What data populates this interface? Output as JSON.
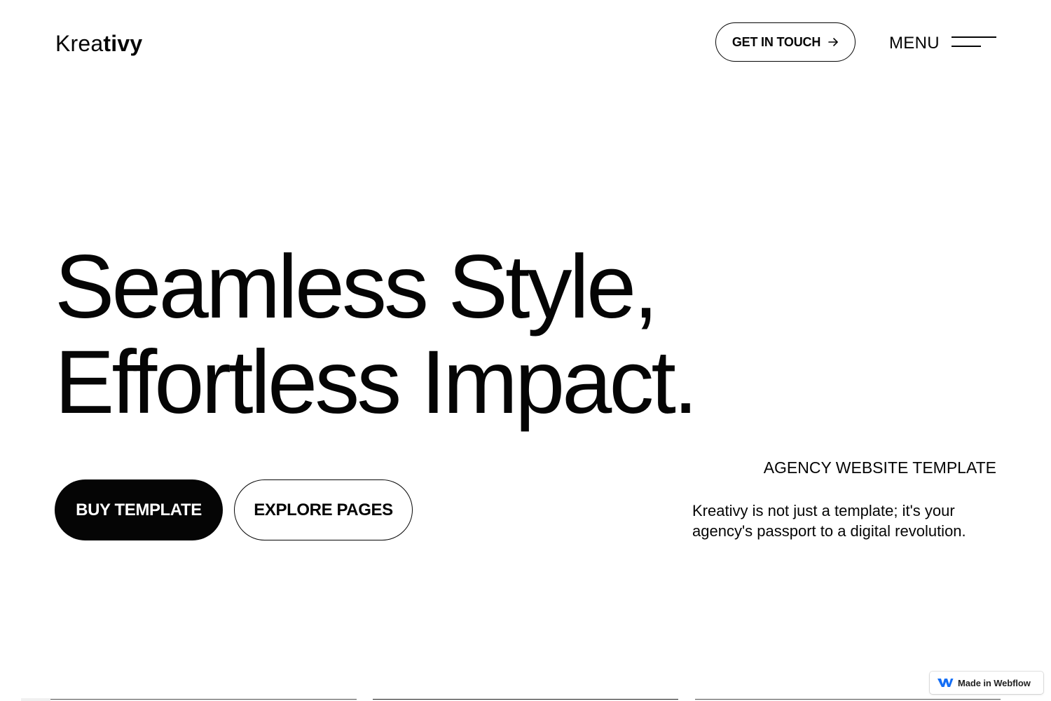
{
  "header": {
    "logo_light": "Krea",
    "logo_bold": "tivy",
    "cta_label": "GET IN TOUCH",
    "menu_label": "MENU"
  },
  "hero": {
    "headline_line1": "Seamless Style,",
    "headline_line2": "Effortless Impact.",
    "primary_button": "BUY TEMPLATE",
    "secondary_button": "EXPLORE PAGES",
    "eyebrow": "AGENCY WEBSITE TEMPLATE",
    "description": "Kreativy is not just a template; it's your agency's passport to a digital revolution."
  },
  "badge": {
    "label": "Made in Webflow"
  },
  "colors": {
    "text": "#050505",
    "background": "#ffffff",
    "webflow_blue": "#146ef5"
  },
  "icons": {
    "cta": "arrow-right-icon",
    "menu": "hamburger-menu-icon",
    "badge": "webflow-logo-icon"
  }
}
